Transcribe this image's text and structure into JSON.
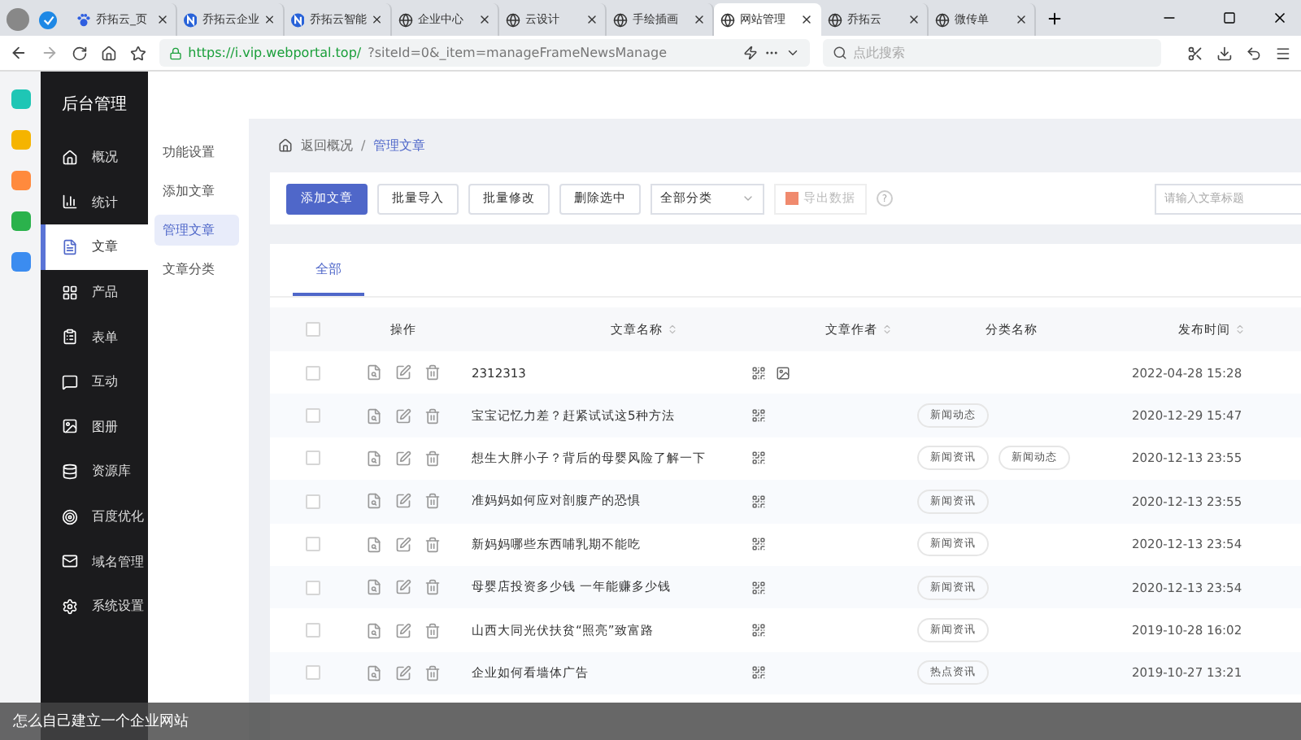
{
  "browser": {
    "tabs": [
      {
        "title": "乔拓云_页",
        "selected": false
      },
      {
        "title": "乔拓云企业",
        "selected": false
      },
      {
        "title": "乔拓云智能",
        "selected": false
      },
      {
        "title": "企业中心",
        "selected": false
      },
      {
        "title": "云设计",
        "selected": false
      },
      {
        "title": "手绘插画",
        "selected": false
      },
      {
        "title": "网站管理",
        "selected": true
      },
      {
        "title": "乔拓云",
        "selected": false
      },
      {
        "title": "微传单",
        "selected": false
      }
    ],
    "url_host": "https://i.vip.webportal.top/",
    "url_rest": "?siteId=0&_item=manageFrameNewsManage",
    "search_placeholder": "点此搜索"
  },
  "sidebar": {
    "title": "后台管理",
    "items": [
      {
        "label": "概况",
        "selected": false
      },
      {
        "label": "统计",
        "selected": false
      },
      {
        "label": "文章",
        "selected": true
      },
      {
        "label": "产品",
        "selected": false
      },
      {
        "label": "表单",
        "selected": false
      },
      {
        "label": "互动",
        "selected": false
      },
      {
        "label": "图册",
        "selected": false
      },
      {
        "label": "资源库",
        "selected": false
      },
      {
        "label": "百度优化",
        "selected": false
      },
      {
        "label": "域名管理",
        "selected": false
      },
      {
        "label": "系统设置",
        "selected": false
      }
    ]
  },
  "submenu": [
    {
      "label": "功能设置",
      "selected": false
    },
    {
      "label": "添加文章",
      "selected": false
    },
    {
      "label": "管理文章",
      "selected": true
    },
    {
      "label": "文章分类",
      "selected": false
    }
  ],
  "breadcrumb": {
    "back": "返回概况",
    "separator": "/",
    "current": "管理文章"
  },
  "toolbar": {
    "buttons": [
      {
        "label": "添加文章",
        "kind": "primary"
      },
      {
        "label": "批量导入",
        "kind": "default"
      },
      {
        "label": "批量修改",
        "kind": "default"
      },
      {
        "label": "删除选中",
        "kind": "default"
      }
    ],
    "category_select": "全部分类",
    "export": {
      "label": "导出数据",
      "disabled": true
    },
    "help": "?",
    "search_placeholder": "请输入文章标题"
  },
  "content_tabs": [
    {
      "label": "全部",
      "selected": true
    }
  ],
  "table": {
    "all_checked": false,
    "columns": [
      "操作",
      "文章名称",
      "文章作者",
      "分类名称",
      "发布时间"
    ],
    "rows": [
      {
        "checked": false,
        "title": "2312313",
        "has_image": true,
        "categories": [],
        "time": "2022-04-28 15:28"
      },
      {
        "checked": false,
        "title": "宝宝记忆力差？赶紧试试这5种方法",
        "has_image": false,
        "categories": [
          "新闻动态"
        ],
        "time": "2020-12-29 15:47"
      },
      {
        "checked": false,
        "title": "想生大胖小子？背后的母婴风险了解一下",
        "has_image": false,
        "categories": [
          "新闻资讯",
          "新闻动态"
        ],
        "time": "2020-12-13 23:55"
      },
      {
        "checked": false,
        "title": "准妈妈如何应对剖腹产的恐惧",
        "has_image": false,
        "categories": [
          "新闻资讯"
        ],
        "time": "2020-12-13 23:55"
      },
      {
        "checked": false,
        "title": "新妈妈哪些东西哺乳期不能吃",
        "has_image": false,
        "categories": [
          "新闻资讯"
        ],
        "time": "2020-12-13 23:54"
      },
      {
        "checked": false,
        "title": "母婴店投资多少钱 一年能赚多少钱",
        "has_image": false,
        "categories": [
          "新闻资讯"
        ],
        "time": "2020-12-13 23:54"
      },
      {
        "checked": false,
        "title": "山西大同光伏扶贫“照亮”致富路",
        "has_image": false,
        "categories": [
          "新闻资讯"
        ],
        "time": "2019-10-28 16:02"
      },
      {
        "checked": false,
        "title": "企业如何看墙体广告",
        "has_image": false,
        "categories": [
          "热点资讯"
        ],
        "time": "2019-10-27 13:21"
      }
    ]
  },
  "caption": "怎么自己建立一个企业网站"
}
